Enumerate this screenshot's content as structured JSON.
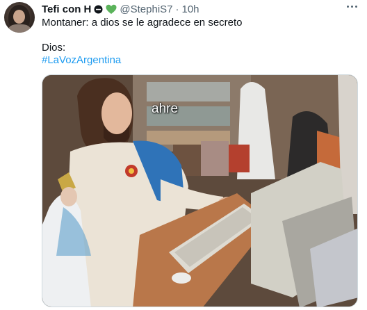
{
  "tweet": {
    "display_name": "Tefi con H",
    "handle": "@StephiS7",
    "separator": "·",
    "time": "10h",
    "text_line1": "Montaner: a dios se le agradece en secreto",
    "text_line2": "Dios:",
    "hashtag": "#LaVozArgentina"
  },
  "media": {
    "caption": "ahre"
  },
  "icons": {
    "identity": "circle-ident-icon",
    "heart": "green-heart-icon",
    "more": "more-horizontal-icon"
  },
  "colors": {
    "link": "#1d9bf0",
    "secondary_text": "#536471",
    "heart": "#5bb35b"
  }
}
